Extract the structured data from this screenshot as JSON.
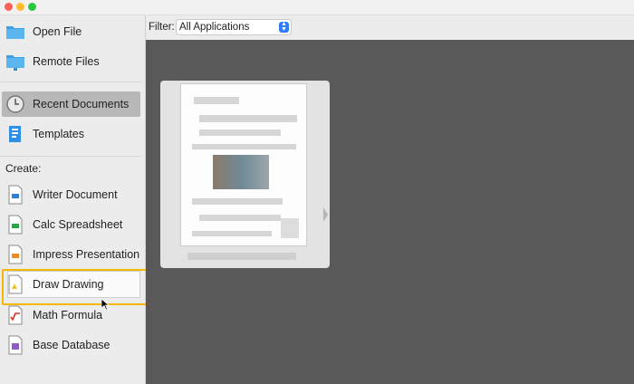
{
  "sidebar": {
    "items": [
      {
        "label": "Open File",
        "icon": "folder-icon"
      },
      {
        "label": "Remote Files",
        "icon": "remote-folder-icon"
      },
      {
        "label": "Recent Documents",
        "icon": "clock-icon"
      },
      {
        "label": "Templates",
        "icon": "templates-icon"
      }
    ],
    "create_label": "Create:",
    "create_items": [
      {
        "label": "Writer Document",
        "icon": "writer-icon"
      },
      {
        "label": "Calc Spreadsheet",
        "icon": "calc-icon"
      },
      {
        "label": "Impress Presentation",
        "icon": "impress-icon"
      },
      {
        "label": "Draw Drawing",
        "icon": "draw-icon"
      },
      {
        "label": "Math Formula",
        "icon": "math-icon"
      },
      {
        "label": "Base Database",
        "icon": "base-icon"
      }
    ]
  },
  "filter": {
    "label": "Filter:",
    "selected": "All Applications"
  },
  "colors": {
    "highlight": "#f5b800",
    "content_bg": "#595959",
    "selected_item": "#b8b8b8"
  }
}
